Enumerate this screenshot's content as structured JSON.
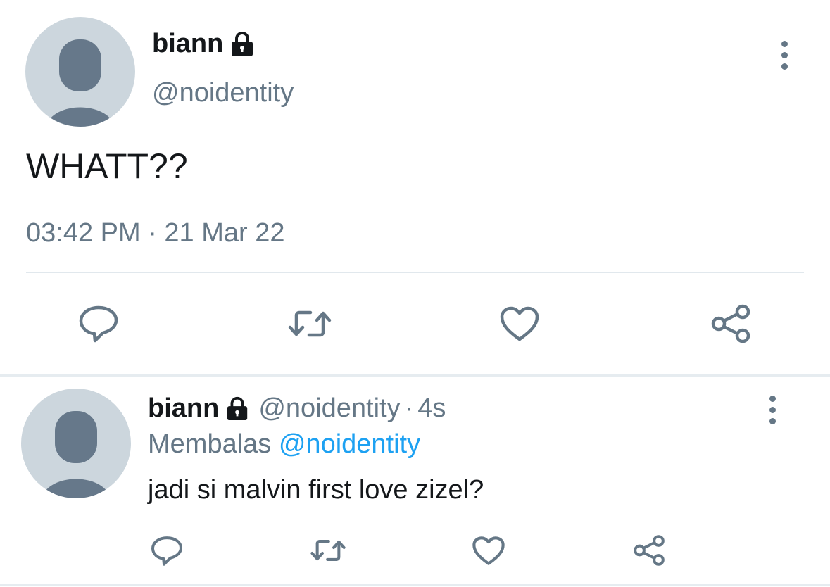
{
  "main_tweet": {
    "display_name": "biann",
    "handle": "@noidentity",
    "text": "WHATT??",
    "timestamp": "03:42 PM · 21 Mar 22",
    "icons": {
      "avatar": "default-avatar-icon",
      "lock": "lock-icon",
      "more": "more-vertical-icon",
      "reply": "reply-icon",
      "retweet": "retweet-icon",
      "like": "heart-icon",
      "share": "share-icon"
    }
  },
  "reply_tweet": {
    "display_name": "biann",
    "handle": "@noidentity",
    "separator": "·",
    "time": "4s",
    "replying_to_label": "Membalas",
    "replying_to_handle": "@noidentity",
    "text": "jadi si malvin first love zizel?"
  },
  "colors": {
    "primary_text": "#14171a",
    "secondary_text": "#657786",
    "link": "#1da1f2",
    "avatar_bg": "#ccd6dd",
    "avatar_fg": "#66788a",
    "divider": "#e1e8ed"
  }
}
